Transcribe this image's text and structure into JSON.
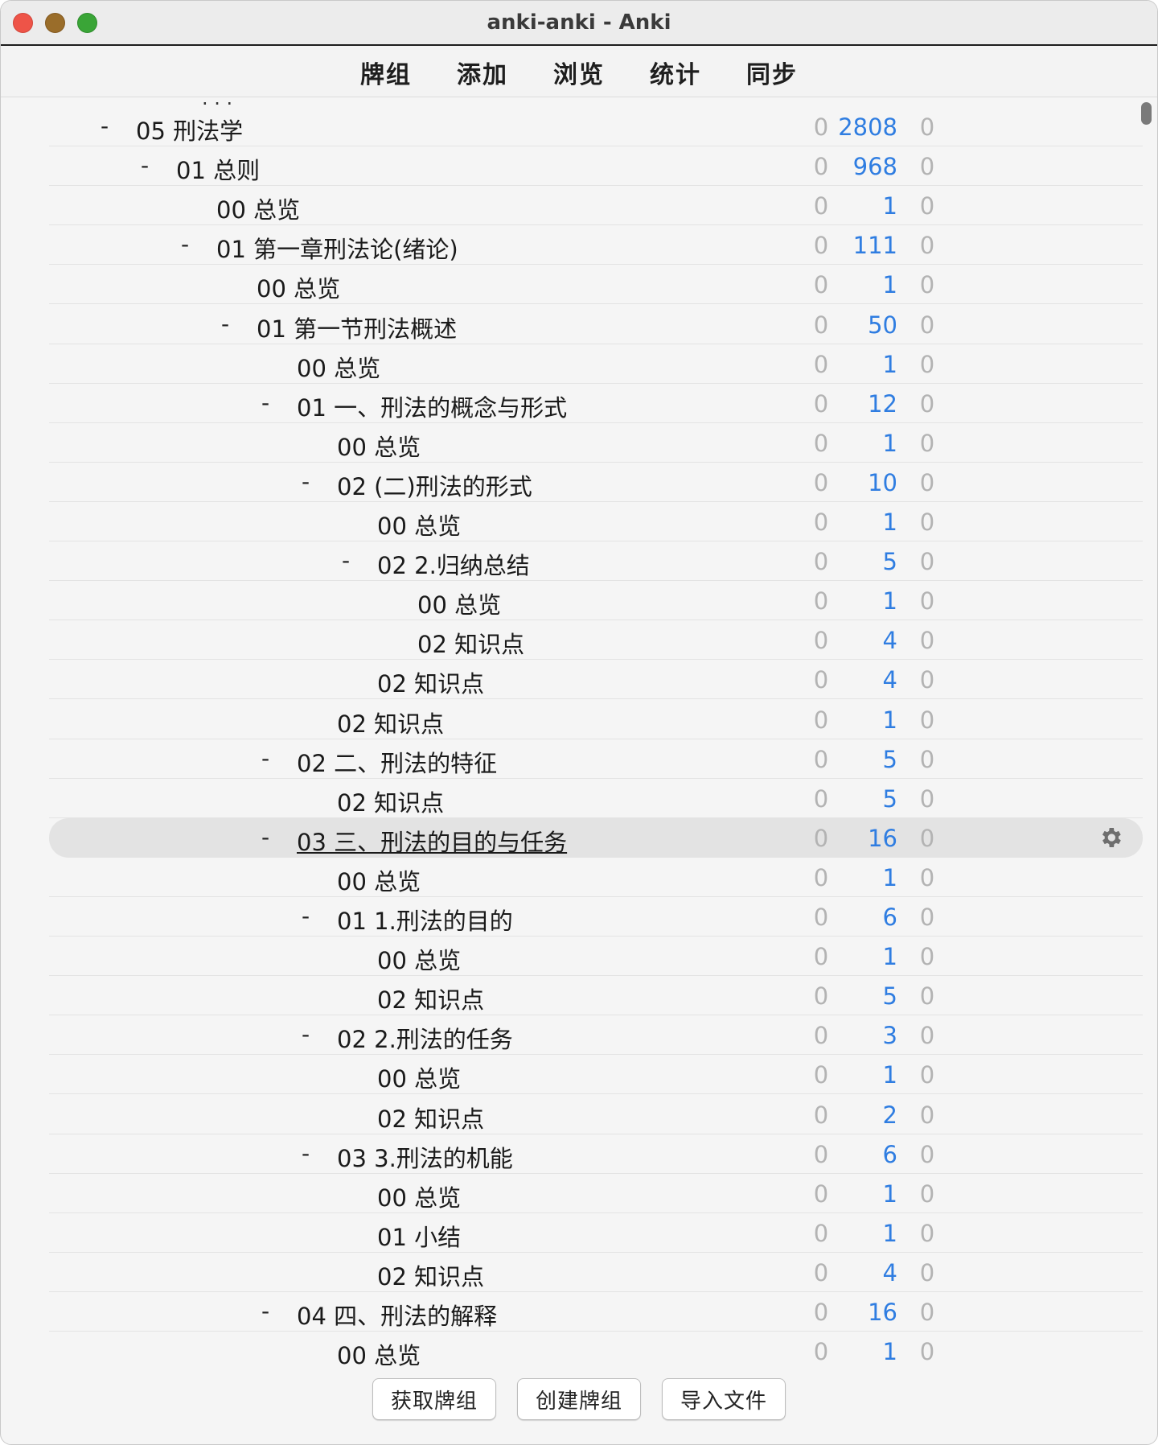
{
  "window": {
    "title": "anki-anki - Anki"
  },
  "toolbar": {
    "decks": "牌组",
    "add": "添加",
    "browse": "浏览",
    "stats": "统计",
    "sync": "同步"
  },
  "cutoff_text": "· · ·",
  "decks": [
    {
      "name": "05 刑法学",
      "level": 0,
      "collapse": "-",
      "new": "2808",
      "learn": "0",
      "due": "0"
    },
    {
      "name": "01 总则",
      "level": 1,
      "collapse": "-",
      "new": "968",
      "learn": "0",
      "due": "0"
    },
    {
      "name": "00 总览",
      "level": 2,
      "collapse": "",
      "new": "1",
      "learn": "0",
      "due": "0"
    },
    {
      "name": "01 第一章刑法论(绪论)",
      "level": 2,
      "collapse": "-",
      "new": "111",
      "learn": "0",
      "due": "0"
    },
    {
      "name": "00 总览",
      "level": 3,
      "collapse": "",
      "new": "1",
      "learn": "0",
      "due": "0"
    },
    {
      "name": "01 第一节刑法概述",
      "level": 3,
      "collapse": "-",
      "new": "50",
      "learn": "0",
      "due": "0"
    },
    {
      "name": "00 总览",
      "level": 4,
      "collapse": "",
      "new": "1",
      "learn": "0",
      "due": "0"
    },
    {
      "name": "01 一、刑法的概念与形式",
      "level": 4,
      "collapse": "-",
      "new": "12",
      "learn": "0",
      "due": "0"
    },
    {
      "name": "00 总览",
      "level": 5,
      "collapse": "",
      "new": "1",
      "learn": "0",
      "due": "0"
    },
    {
      "name": "02 (二)刑法的形式",
      "level": 5,
      "collapse": "-",
      "new": "10",
      "learn": "0",
      "due": "0"
    },
    {
      "name": "00 总览",
      "level": 6,
      "collapse": "",
      "new": "1",
      "learn": "0",
      "due": "0"
    },
    {
      "name": "02 2.归纳总结",
      "level": 6,
      "collapse": "-",
      "new": "5",
      "learn": "0",
      "due": "0"
    },
    {
      "name": "00 总览",
      "level": 7,
      "collapse": "",
      "new": "1",
      "learn": "0",
      "due": "0"
    },
    {
      "name": "02 知识点",
      "level": 7,
      "collapse": "",
      "new": "4",
      "learn": "0",
      "due": "0"
    },
    {
      "name": "02 知识点",
      "level": 6,
      "collapse": "",
      "new": "4",
      "learn": "0",
      "due": "0"
    },
    {
      "name": "02 知识点",
      "level": 5,
      "collapse": "",
      "new": "1",
      "learn": "0",
      "due": "0"
    },
    {
      "name": "02 二、刑法的特征",
      "level": 4,
      "collapse": "-",
      "new": "5",
      "learn": "0",
      "due": "0"
    },
    {
      "name": "02 知识点",
      "level": 5,
      "collapse": "",
      "new": "5",
      "learn": "0",
      "due": "0"
    },
    {
      "name": "03 三、刑法的目的与任务",
      "level": 4,
      "collapse": "-",
      "new": "16",
      "learn": "0",
      "due": "0",
      "current": true
    },
    {
      "name": "00 总览",
      "level": 5,
      "collapse": "",
      "new": "1",
      "learn": "0",
      "due": "0"
    },
    {
      "name": "01 1.刑法的目的",
      "level": 5,
      "collapse": "-",
      "new": "6",
      "learn": "0",
      "due": "0"
    },
    {
      "name": "00 总览",
      "level": 6,
      "collapse": "",
      "new": "1",
      "learn": "0",
      "due": "0"
    },
    {
      "name": "02 知识点",
      "level": 6,
      "collapse": "",
      "new": "5",
      "learn": "0",
      "due": "0"
    },
    {
      "name": "02 2.刑法的任务",
      "level": 5,
      "collapse": "-",
      "new": "3",
      "learn": "0",
      "due": "0"
    },
    {
      "name": "00 总览",
      "level": 6,
      "collapse": "",
      "new": "1",
      "learn": "0",
      "due": "0"
    },
    {
      "name": "02 知识点",
      "level": 6,
      "collapse": "",
      "new": "2",
      "learn": "0",
      "due": "0"
    },
    {
      "name": "03 3.刑法的机能",
      "level": 5,
      "collapse": "-",
      "new": "6",
      "learn": "0",
      "due": "0"
    },
    {
      "name": "00 总览",
      "level": 6,
      "collapse": "",
      "new": "1",
      "learn": "0",
      "due": "0"
    },
    {
      "name": "01 小结",
      "level": 6,
      "collapse": "",
      "new": "1",
      "learn": "0",
      "due": "0"
    },
    {
      "name": "02 知识点",
      "level": 6,
      "collapse": "",
      "new": "4",
      "learn": "0",
      "due": "0"
    },
    {
      "name": "04 四、刑法的解释",
      "level": 4,
      "collapse": "-",
      "new": "16",
      "learn": "0",
      "due": "0"
    },
    {
      "name": "00 总览",
      "level": 5,
      "collapse": "",
      "new": "1",
      "learn": "0",
      "due": "0"
    }
  ],
  "buttons": {
    "get_shared": "获取牌组",
    "create_deck": "创建牌组",
    "import_file": "导入文件"
  },
  "colors": {
    "new_count": "#2f7de1",
    "zero_count": "#b3b3b3",
    "current_row": "#e3e3e3"
  },
  "icons": {
    "gear": "gear-icon"
  }
}
